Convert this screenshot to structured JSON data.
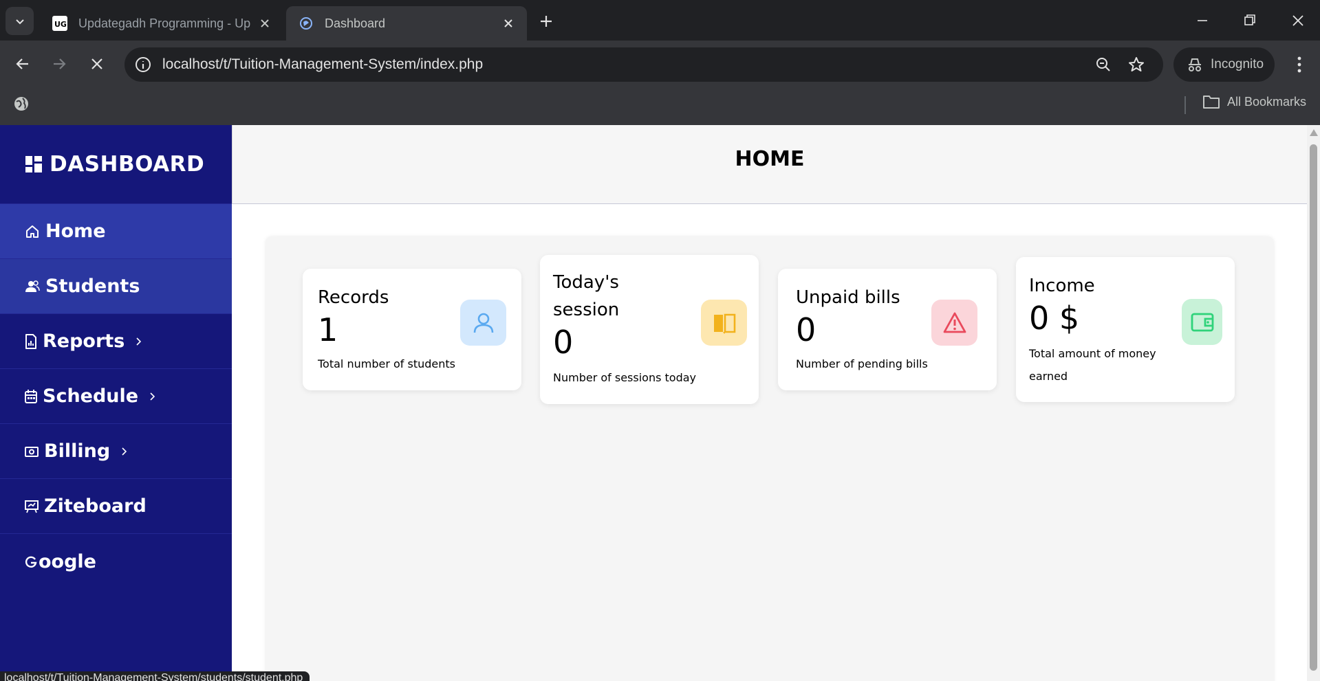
{
  "browser": {
    "tabs": [
      {
        "title": "Updategadh Programming - Up",
        "favicon": "updategadh-favicon"
      },
      {
        "title": "Dashboard",
        "favicon": "loading-globe-icon"
      }
    ],
    "url": "localhost/t/Tuition-Management-System/index.php",
    "profile_label": "Incognito",
    "bookmarks_label": "All Bookmarks",
    "status_url": "localhost/t/Tuition-Management-System/students/student.php"
  },
  "sidebar": {
    "brand": "DASHBOARD",
    "items": [
      {
        "label": "Home",
        "icon": "home-icon",
        "has_submenu": false
      },
      {
        "label": "Students",
        "icon": "users-icon",
        "has_submenu": false
      },
      {
        "label": "Reports",
        "icon": "report-icon",
        "has_submenu": true
      },
      {
        "label": "Schedule",
        "icon": "calendar-icon",
        "has_submenu": true
      },
      {
        "label": "Billing",
        "icon": "money-icon",
        "has_submenu": true
      },
      {
        "label": "Ziteboard",
        "icon": "presentation-icon",
        "has_submenu": false
      },
      {
        "label": "oogle",
        "icon": "google-icon",
        "has_submenu": false
      }
    ]
  },
  "header": {
    "title": "HOME"
  },
  "cards": [
    {
      "title": "Records",
      "value": "1",
      "description": "Total number of students",
      "icon": "user-icon",
      "badge_color": "#d3e8fd",
      "icon_color": "#5aa9f0"
    },
    {
      "title": "Today's session",
      "value": "0",
      "description": "Number of sessions today",
      "icon": "book-icon",
      "badge_color": "#fde7b0",
      "icon_color": "#f2b21c"
    },
    {
      "title": "Unpaid bills",
      "value": "0",
      "description": "Number of pending bills",
      "icon": "warning-icon",
      "badge_color": "#fbd5da",
      "icon_color": "#e9495c"
    },
    {
      "title": "Income",
      "value": "0 $",
      "description": "Total amount of money earned",
      "icon": "wallet-icon",
      "badge_color": "#c8f2d8",
      "icon_color": "#2fd37a"
    }
  ],
  "colors": {
    "sidebar": "#15177a",
    "sidebar_active": "#2e3aa8",
    "panel": "#f5f5f5"
  }
}
